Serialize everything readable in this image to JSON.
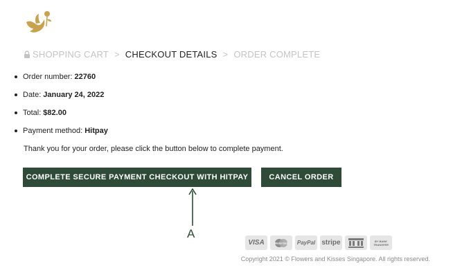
{
  "breadcrumb": {
    "items": [
      {
        "label": "SHOPPING CART",
        "state": "inactive"
      },
      {
        "label": "CHECKOUT DETAILS",
        "state": "active"
      },
      {
        "label": "ORDER COMPLETE",
        "state": "inactive"
      }
    ],
    "separator": ">"
  },
  "order": {
    "number_label": "Order number:",
    "number": "22760",
    "date_label": "Date:",
    "date": "January 24, 2022",
    "total_label": "Total:",
    "total": "$82.00",
    "method_label": "Payment method:",
    "method": "Hitpay"
  },
  "message": "Thank you for your order, please click the button below to complete payment.",
  "buttons": {
    "pay_label": "COMPLETE SECURE PAYMENT CHECKOUT WITH HITPAY",
    "cancel_label": "CANCEL ORDER"
  },
  "annotation": {
    "label": "A"
  },
  "payment_icons": {
    "visa": "VISA",
    "mastercard": "MasterCard",
    "paypal": "PayPal",
    "stripe": "stripe",
    "bank_transfer": "BY BANK TRANSFER"
  },
  "footer": {
    "copyright": "Copyright 2021 © Flowers and Kisses Singapore. All rights reserved."
  },
  "colors": {
    "brand_green": "#2d4b36",
    "logo_gold": "#c9a24a",
    "muted": "#c4c4c4"
  }
}
